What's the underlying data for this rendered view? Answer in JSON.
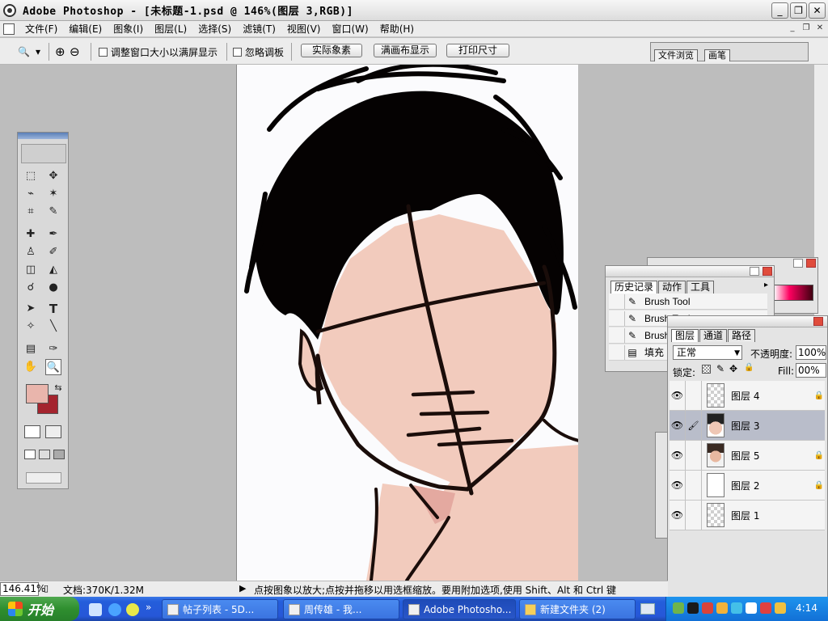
{
  "window": {
    "title": "Adobe Photoshop - [未标题-1.psd @ 146%(图层 3,RGB)]",
    "min_label": "_",
    "restore_label": "❐",
    "close_label": "✕"
  },
  "menu": {
    "items": [
      "文件(F)",
      "编辑(E)",
      "图象(I)",
      "图层(L)",
      "选择(S)",
      "滤镜(T)",
      "视图(V)",
      "窗口(W)",
      "帮助(H)"
    ],
    "mdi_min": "_",
    "mdi_restore": "❐",
    "mdi_close": "✕"
  },
  "options": {
    "zoom_glyph": "🔍",
    "dropdown_glyph": "▾",
    "zoom_in": "⊕",
    "zoom_out": "⊖",
    "resize_window_label": "调整窗口大小以满屏显示",
    "ignore_palettes_label": "忽略调板",
    "actual_pixels": "实际象素",
    "fit_on_screen": "满画布显示",
    "print_size": "打印尺寸",
    "well_tabs": [
      "文件浏览",
      "画笔"
    ]
  },
  "toolbox": {
    "tools": [
      "⬚",
      "✥",
      "⌁",
      "✶",
      "⌗",
      "✎",
      "✚",
      "✒",
      "♙",
      "✐",
      "◫",
      "◭",
      "☌",
      "●",
      "➤",
      "T",
      "✧",
      "╲",
      "▤",
      "✑",
      "✋",
      "🔍"
    ],
    "swap_glyph": "⇆",
    "fg_color": "#e9b5ac",
    "bg_color": "#a4242e"
  },
  "history": {
    "tabs": [
      "历史记录",
      "动作",
      "工具"
    ],
    "rows": [
      "Brush Tool",
      "Brush Tool",
      "Brush Tool",
      "填充"
    ],
    "arrow": "▸"
  },
  "layers": {
    "tabs": [
      "图层",
      "通道",
      "路径"
    ],
    "blend_mode": "正常",
    "opacity_label": "不透明度:",
    "opacity_value": "100%",
    "lock_label": "锁定:",
    "fill_label": "Fill:",
    "fill_value": "00%",
    "rows": [
      {
        "name": "图层 4",
        "eye": "👁",
        "link": "",
        "lock": "🔒"
      },
      {
        "name": "图层 3",
        "eye": "👁",
        "link": "🖌",
        "lock": ""
      },
      {
        "name": "图层 5",
        "eye": "👁",
        "link": "",
        "lock": "🔒"
      },
      {
        "name": "图层 2",
        "eye": "👁",
        "link": "",
        "lock": "🔒"
      },
      {
        "name": "图层 1",
        "eye": "👁",
        "link": "",
        "lock": ""
      }
    ]
  },
  "status": {
    "zoom": "146.41%",
    "doc": "文档:370K/1.32M",
    "arrow": "▶",
    "hint": "点按图象以放大;点按并拖移以用选框缩放。要用附加选项,使用 Shift、Alt 和 Ctrl 键"
  },
  "taskbar": {
    "start": "开始",
    "more": "»",
    "tasks": [
      "帖子列表 - 5D...",
      "周传雄 - 我...",
      "Adobe Photosho...",
      "新建文件夹 (2)"
    ],
    "clock": "4:14"
  },
  "colors": {
    "skin": "#f2cbbd",
    "hair": "#050202",
    "line": "#1a0d0a"
  }
}
